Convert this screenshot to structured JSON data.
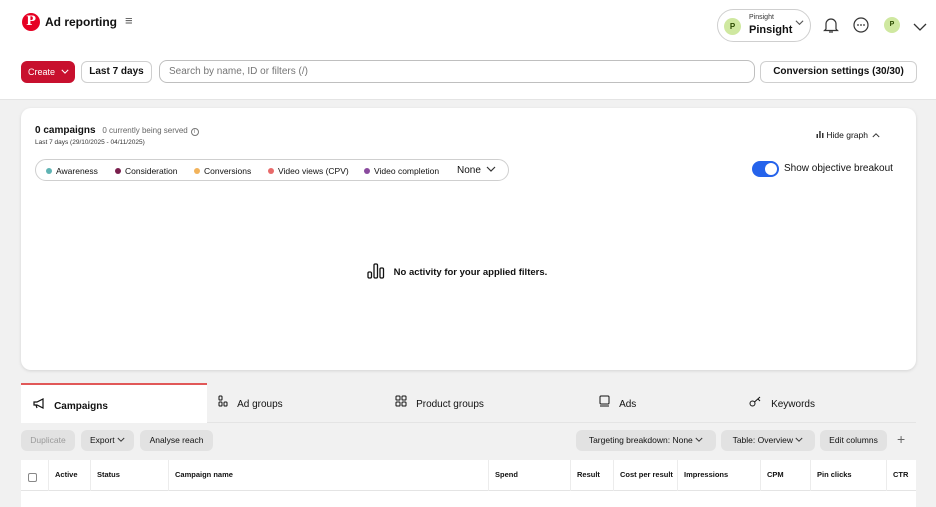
{
  "header": {
    "logo": "P",
    "title": "Ad reporting",
    "menu_icon": "hamburger-icon",
    "account": {
      "initial": "P",
      "label_small": "Pinsight",
      "label_main": "Pinsight"
    },
    "profile_initial": "P"
  },
  "toolbar": {
    "create_label": "Create",
    "date_label": "Last 7 days",
    "search_placeholder": "Search by name, ID or filters (/)",
    "conversion_label": "Conversion settings (30/30)"
  },
  "summary": {
    "count_label": "0 campaigns",
    "served_label": "0 currently being served",
    "date_range": "Last 7 days (29/10/2025 - 04/11/2025)",
    "hide_graph_label": "Hide graph",
    "objectives": [
      {
        "label": "Awareness",
        "color": "#5fb3b3"
      },
      {
        "label": "Consideration",
        "color": "#7a1f4d"
      },
      {
        "label": "Conversions",
        "color": "#f2b35b"
      },
      {
        "label": "Video views (CPV)",
        "color": "#e86a6a"
      },
      {
        "label": "Video completion",
        "color": "#8a4a9e"
      }
    ],
    "none_label": "None",
    "breakout_label": "Show objective breakout",
    "breakout_on": true,
    "empty_message": "No activity for your applied filters."
  },
  "tabs": [
    {
      "label": "Campaigns",
      "icon": "megaphone-icon"
    },
    {
      "label": "Ad groups",
      "icon": "ad-groups-icon"
    },
    {
      "label": "Product groups",
      "icon": "grid-icon"
    },
    {
      "label": "Ads",
      "icon": "ad-icon"
    },
    {
      "label": "Keywords",
      "icon": "key-icon"
    }
  ],
  "actions": {
    "duplicate": "Duplicate",
    "export": "Export",
    "analyse": "Analyse reach",
    "targeting": "Targeting breakdown: None",
    "table_view": "Table: Overview",
    "edit_columns": "Edit columns"
  },
  "table": {
    "columns": [
      "Active",
      "Status",
      "Campaign name",
      "Spend",
      "Result",
      "Cost per result",
      "Impressions",
      "CPM",
      "Pin clicks",
      "CTR"
    ]
  },
  "colors": {
    "brand": "#e60023",
    "create": "#c8102e",
    "toggle": "#2563eb",
    "tab_accent": "#e15858"
  }
}
